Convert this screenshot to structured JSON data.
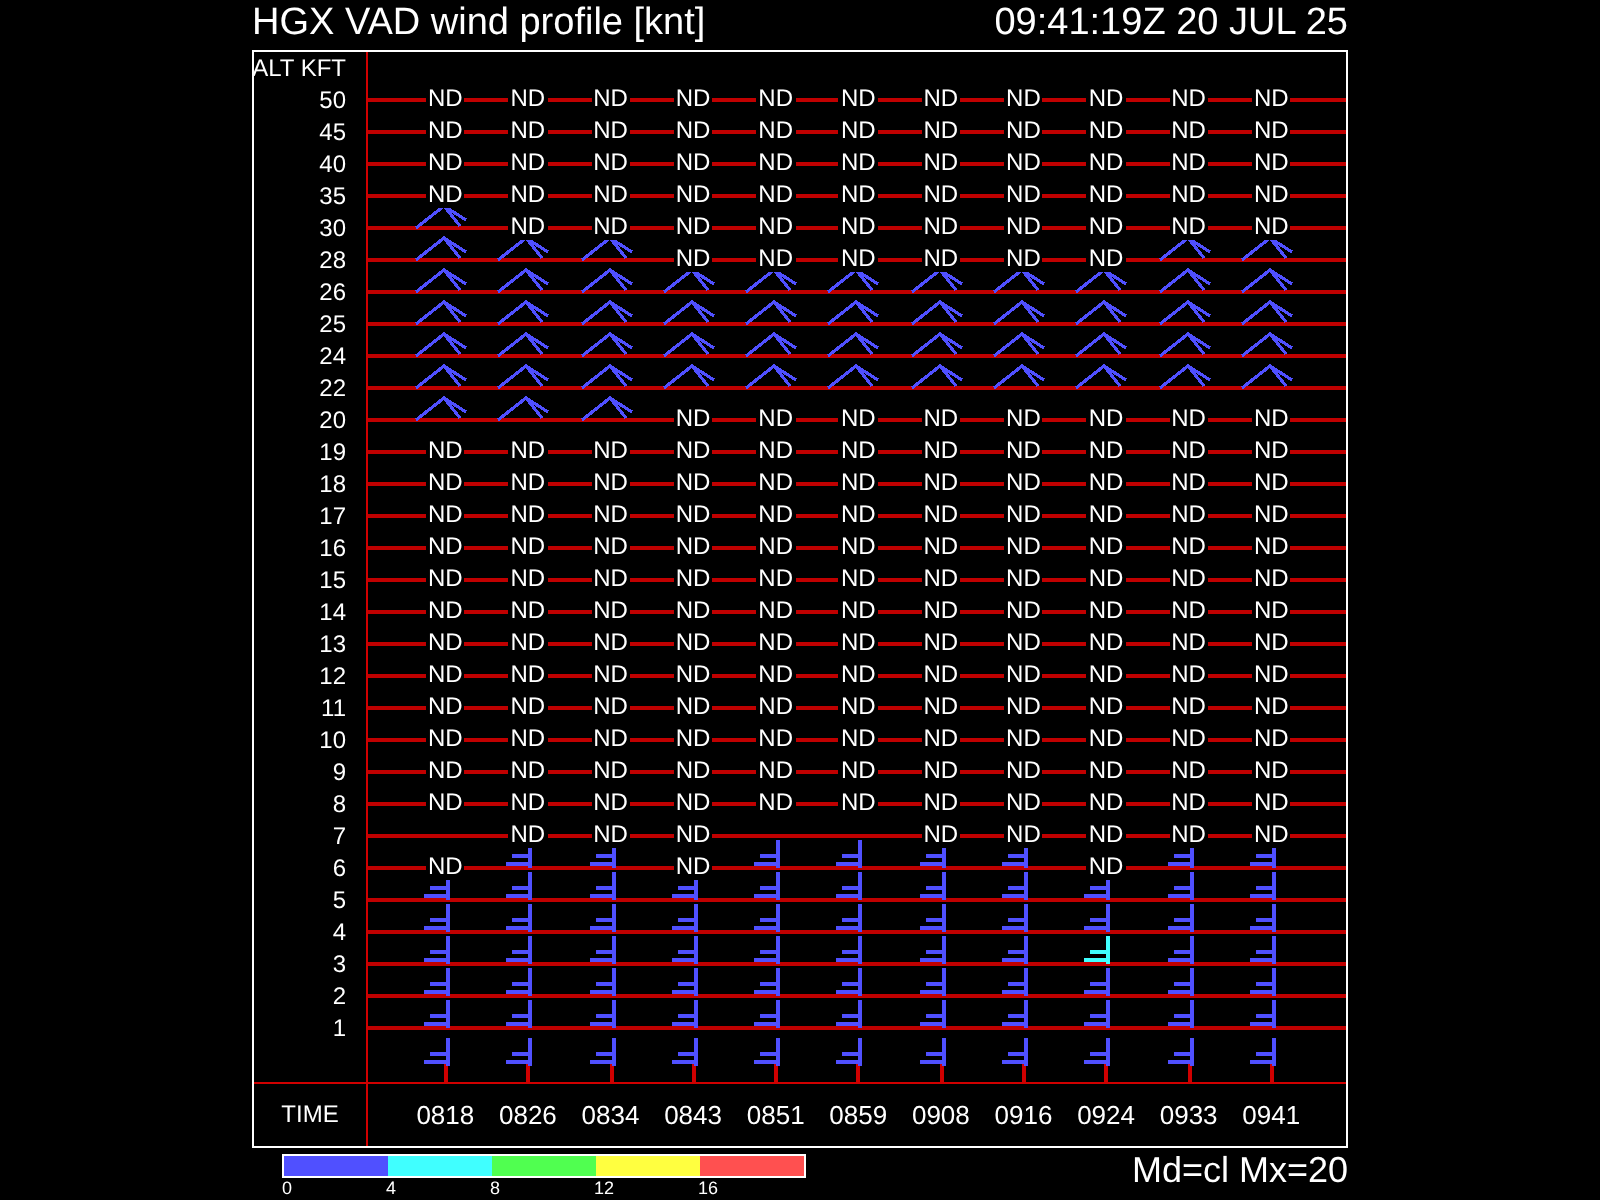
{
  "header": {
    "title": "HGX VAD wind profile [knt]",
    "timestamp": "09:41:19Z 20 JUL 25"
  },
  "profile": {
    "axis_label": "ALT KFT",
    "rows": [
      {
        "altitude": "50",
        "cells": [
          {
            "kind": "nd",
            "text": "ND"
          },
          {
            "kind": "nd",
            "text": "ND"
          },
          {
            "kind": "nd",
            "text": "ND"
          },
          {
            "kind": "nd",
            "text": "ND"
          },
          {
            "kind": "nd",
            "text": "ND"
          },
          {
            "kind": "nd",
            "text": "ND"
          },
          {
            "kind": "nd",
            "text": "ND"
          },
          {
            "kind": "nd",
            "text": "ND"
          },
          {
            "kind": "nd",
            "text": "ND"
          },
          {
            "kind": "nd",
            "text": "ND"
          },
          {
            "kind": "nd",
            "text": "ND"
          }
        ]
      },
      {
        "altitude": "45",
        "cells": [
          {
            "kind": "nd",
            "text": "ND"
          },
          {
            "kind": "nd",
            "text": "ND"
          },
          {
            "kind": "nd",
            "text": "ND"
          },
          {
            "kind": "nd",
            "text": "ND"
          },
          {
            "kind": "nd",
            "text": "ND"
          },
          {
            "kind": "nd",
            "text": "ND"
          },
          {
            "kind": "nd",
            "text": "ND"
          },
          {
            "kind": "nd",
            "text": "ND"
          },
          {
            "kind": "nd",
            "text": "ND"
          },
          {
            "kind": "nd",
            "text": "ND"
          },
          {
            "kind": "nd",
            "text": "ND"
          }
        ]
      },
      {
        "altitude": "40",
        "cells": [
          {
            "kind": "nd",
            "text": "ND"
          },
          {
            "kind": "nd",
            "text": "ND"
          },
          {
            "kind": "nd",
            "text": "ND"
          },
          {
            "kind": "nd",
            "text": "ND"
          },
          {
            "kind": "nd",
            "text": "ND"
          },
          {
            "kind": "nd",
            "text": "ND"
          },
          {
            "kind": "nd",
            "text": "ND"
          },
          {
            "kind": "nd",
            "text": "ND"
          },
          {
            "kind": "nd",
            "text": "ND"
          },
          {
            "kind": "nd",
            "text": "ND"
          },
          {
            "kind": "nd",
            "text": "ND"
          }
        ]
      },
      {
        "altitude": "35",
        "cells": [
          {
            "kind": "nd",
            "text": "ND"
          },
          {
            "kind": "nd",
            "text": "ND"
          },
          {
            "kind": "nd",
            "text": "ND"
          },
          {
            "kind": "nd",
            "text": "ND"
          },
          {
            "kind": "nd",
            "text": "ND"
          },
          {
            "kind": "nd",
            "text": "ND"
          },
          {
            "kind": "nd",
            "text": "ND"
          },
          {
            "kind": "nd",
            "text": "ND"
          },
          {
            "kind": "nd",
            "text": "ND"
          },
          {
            "kind": "nd",
            "text": "ND"
          },
          {
            "kind": "nd",
            "text": "ND"
          }
        ]
      },
      {
        "altitude": "30",
        "cells": [
          {
            "kind": "barb",
            "color": "#5050ff"
          },
          {
            "kind": "nd",
            "text": "ND"
          },
          {
            "kind": "nd",
            "text": "ND"
          },
          {
            "kind": "nd",
            "text": "ND"
          },
          {
            "kind": "nd",
            "text": "ND"
          },
          {
            "kind": "nd",
            "text": "ND"
          },
          {
            "kind": "nd",
            "text": "ND"
          },
          {
            "kind": "nd",
            "text": "ND"
          },
          {
            "kind": "nd",
            "text": "ND"
          },
          {
            "kind": "nd",
            "text": "ND"
          },
          {
            "kind": "nd",
            "text": "ND"
          }
        ]
      },
      {
        "altitude": "28",
        "cells": [
          {
            "kind": "barb",
            "color": "#5050ff"
          },
          {
            "kind": "barb",
            "color": "#5050ff"
          },
          {
            "kind": "barb",
            "color": "#5050ff"
          },
          {
            "kind": "nd",
            "text": "ND"
          },
          {
            "kind": "nd",
            "text": "ND"
          },
          {
            "kind": "nd",
            "text": "ND"
          },
          {
            "kind": "nd",
            "text": "ND"
          },
          {
            "kind": "nd",
            "text": "ND"
          },
          {
            "kind": "nd",
            "text": "ND"
          },
          {
            "kind": "barb",
            "color": "#5050ff"
          },
          {
            "kind": "barb",
            "color": "#5050ff"
          }
        ]
      },
      {
        "altitude": "26",
        "cells": [
          {
            "kind": "barb",
            "color": "#5050ff"
          },
          {
            "kind": "barb",
            "color": "#5050ff"
          },
          {
            "kind": "barb",
            "color": "#5050ff"
          },
          {
            "kind": "barb",
            "color": "#5050ff"
          },
          {
            "kind": "barb",
            "color": "#5050ff"
          },
          {
            "kind": "barb",
            "color": "#5050ff"
          },
          {
            "kind": "barb",
            "color": "#5050ff"
          },
          {
            "kind": "barb",
            "color": "#5050ff"
          },
          {
            "kind": "barb",
            "color": "#5050ff"
          },
          {
            "kind": "barb",
            "color": "#5050ff"
          },
          {
            "kind": "barb",
            "color": "#5050ff"
          }
        ]
      },
      {
        "altitude": "25",
        "cells": [
          {
            "kind": "barb",
            "color": "#5050ff"
          },
          {
            "kind": "barb",
            "color": "#5050ff"
          },
          {
            "kind": "barb",
            "color": "#5050ff"
          },
          {
            "kind": "barb",
            "color": "#5050ff"
          },
          {
            "kind": "barb",
            "color": "#5050ff"
          },
          {
            "kind": "barb",
            "color": "#5050ff"
          },
          {
            "kind": "barb",
            "color": "#5050ff"
          },
          {
            "kind": "barb",
            "color": "#5050ff"
          },
          {
            "kind": "barb",
            "color": "#5050ff"
          },
          {
            "kind": "barb",
            "color": "#5050ff"
          },
          {
            "kind": "barb",
            "color": "#5050ff"
          }
        ]
      },
      {
        "altitude": "24",
        "cells": [
          {
            "kind": "barb",
            "color": "#5050ff"
          },
          {
            "kind": "barb",
            "color": "#5050ff"
          },
          {
            "kind": "barb",
            "color": "#5050ff"
          },
          {
            "kind": "barb",
            "color": "#5050ff"
          },
          {
            "kind": "barb",
            "color": "#5050ff"
          },
          {
            "kind": "barb",
            "color": "#5050ff"
          },
          {
            "kind": "barb",
            "color": "#5050ff"
          },
          {
            "kind": "barb",
            "color": "#5050ff"
          },
          {
            "kind": "barb",
            "color": "#5050ff"
          },
          {
            "kind": "barb",
            "color": "#5050ff"
          },
          {
            "kind": "barb",
            "color": "#5050ff"
          }
        ]
      },
      {
        "altitude": "22",
        "cells": [
          {
            "kind": "barb",
            "color": "#5050ff"
          },
          {
            "kind": "barb",
            "color": "#5050ff"
          },
          {
            "kind": "barb",
            "color": "#5050ff"
          },
          {
            "kind": "barb",
            "color": "#5050ff"
          },
          {
            "kind": "barb",
            "color": "#5050ff"
          },
          {
            "kind": "barb",
            "color": "#5050ff"
          },
          {
            "kind": "barb",
            "color": "#5050ff"
          },
          {
            "kind": "barb",
            "color": "#5050ff"
          },
          {
            "kind": "barb",
            "color": "#5050ff"
          },
          {
            "kind": "barb",
            "color": "#5050ff"
          },
          {
            "kind": "barb",
            "color": "#5050ff"
          }
        ]
      },
      {
        "altitude": "20",
        "cells": [
          {
            "kind": "barb",
            "color": "#5050ff"
          },
          {
            "kind": "barb",
            "color": "#5050ff"
          },
          {
            "kind": "barb",
            "color": "#5050ff"
          },
          {
            "kind": "nd",
            "text": "ND"
          },
          {
            "kind": "nd",
            "text": "ND"
          },
          {
            "kind": "nd",
            "text": "ND"
          },
          {
            "kind": "nd",
            "text": "ND"
          },
          {
            "kind": "nd",
            "text": "ND"
          },
          {
            "kind": "nd",
            "text": "ND"
          },
          {
            "kind": "nd",
            "text": "ND"
          },
          {
            "kind": "nd",
            "text": "ND"
          }
        ]
      },
      {
        "altitude": "19",
        "cells": [
          {
            "kind": "nd",
            "text": "ND"
          },
          {
            "kind": "nd",
            "text": "ND"
          },
          {
            "kind": "nd",
            "text": "ND"
          },
          {
            "kind": "nd",
            "text": "ND"
          },
          {
            "kind": "nd",
            "text": "ND"
          },
          {
            "kind": "nd",
            "text": "ND"
          },
          {
            "kind": "nd",
            "text": "ND"
          },
          {
            "kind": "nd",
            "text": "ND"
          },
          {
            "kind": "nd",
            "text": "ND"
          },
          {
            "kind": "nd",
            "text": "ND"
          },
          {
            "kind": "nd",
            "text": "ND"
          }
        ]
      },
      {
        "altitude": "18",
        "cells": [
          {
            "kind": "nd",
            "text": "ND"
          },
          {
            "kind": "nd",
            "text": "ND"
          },
          {
            "kind": "nd",
            "text": "ND"
          },
          {
            "kind": "nd",
            "text": "ND"
          },
          {
            "kind": "nd",
            "text": "ND"
          },
          {
            "kind": "nd",
            "text": "ND"
          },
          {
            "kind": "nd",
            "text": "ND"
          },
          {
            "kind": "nd",
            "text": "ND"
          },
          {
            "kind": "nd",
            "text": "ND"
          },
          {
            "kind": "nd",
            "text": "ND"
          },
          {
            "kind": "nd",
            "text": "ND"
          }
        ]
      },
      {
        "altitude": "17",
        "cells": [
          {
            "kind": "nd",
            "text": "ND"
          },
          {
            "kind": "nd",
            "text": "ND"
          },
          {
            "kind": "nd",
            "text": "ND"
          },
          {
            "kind": "nd",
            "text": "ND"
          },
          {
            "kind": "nd",
            "text": "ND"
          },
          {
            "kind": "nd",
            "text": "ND"
          },
          {
            "kind": "nd",
            "text": "ND"
          },
          {
            "kind": "nd",
            "text": "ND"
          },
          {
            "kind": "nd",
            "text": "ND"
          },
          {
            "kind": "nd",
            "text": "ND"
          },
          {
            "kind": "nd",
            "text": "ND"
          }
        ]
      },
      {
        "altitude": "16",
        "cells": [
          {
            "kind": "nd",
            "text": "ND"
          },
          {
            "kind": "nd",
            "text": "ND"
          },
          {
            "kind": "nd",
            "text": "ND"
          },
          {
            "kind": "nd",
            "text": "ND"
          },
          {
            "kind": "nd",
            "text": "ND"
          },
          {
            "kind": "nd",
            "text": "ND"
          },
          {
            "kind": "nd",
            "text": "ND"
          },
          {
            "kind": "nd",
            "text": "ND"
          },
          {
            "kind": "nd",
            "text": "ND"
          },
          {
            "kind": "nd",
            "text": "ND"
          },
          {
            "kind": "nd",
            "text": "ND"
          }
        ]
      },
      {
        "altitude": "15",
        "cells": [
          {
            "kind": "nd",
            "text": "ND"
          },
          {
            "kind": "nd",
            "text": "ND"
          },
          {
            "kind": "nd",
            "text": "ND"
          },
          {
            "kind": "nd",
            "text": "ND"
          },
          {
            "kind": "nd",
            "text": "ND"
          },
          {
            "kind": "nd",
            "text": "ND"
          },
          {
            "kind": "nd",
            "text": "ND"
          },
          {
            "kind": "nd",
            "text": "ND"
          },
          {
            "kind": "nd",
            "text": "ND"
          },
          {
            "kind": "nd",
            "text": "ND"
          },
          {
            "kind": "nd",
            "text": "ND"
          }
        ]
      },
      {
        "altitude": "14",
        "cells": [
          {
            "kind": "nd",
            "text": "ND"
          },
          {
            "kind": "nd",
            "text": "ND"
          },
          {
            "kind": "nd",
            "text": "ND"
          },
          {
            "kind": "nd",
            "text": "ND"
          },
          {
            "kind": "nd",
            "text": "ND"
          },
          {
            "kind": "nd",
            "text": "ND"
          },
          {
            "kind": "nd",
            "text": "ND"
          },
          {
            "kind": "nd",
            "text": "ND"
          },
          {
            "kind": "nd",
            "text": "ND"
          },
          {
            "kind": "nd",
            "text": "ND"
          },
          {
            "kind": "nd",
            "text": "ND"
          }
        ]
      },
      {
        "altitude": "13",
        "cells": [
          {
            "kind": "nd",
            "text": "ND"
          },
          {
            "kind": "nd",
            "text": "ND"
          },
          {
            "kind": "nd",
            "text": "ND"
          },
          {
            "kind": "nd",
            "text": "ND"
          },
          {
            "kind": "nd",
            "text": "ND"
          },
          {
            "kind": "nd",
            "text": "ND"
          },
          {
            "kind": "nd",
            "text": "ND"
          },
          {
            "kind": "nd",
            "text": "ND"
          },
          {
            "kind": "nd",
            "text": "ND"
          },
          {
            "kind": "nd",
            "text": "ND"
          },
          {
            "kind": "nd",
            "text": "ND"
          }
        ]
      },
      {
        "altitude": "12",
        "cells": [
          {
            "kind": "nd",
            "text": "ND"
          },
          {
            "kind": "nd",
            "text": "ND"
          },
          {
            "kind": "nd",
            "text": "ND"
          },
          {
            "kind": "nd",
            "text": "ND"
          },
          {
            "kind": "nd",
            "text": "ND"
          },
          {
            "kind": "nd",
            "text": "ND"
          },
          {
            "kind": "nd",
            "text": "ND"
          },
          {
            "kind": "nd",
            "text": "ND"
          },
          {
            "kind": "nd",
            "text": "ND"
          },
          {
            "kind": "nd",
            "text": "ND"
          },
          {
            "kind": "nd",
            "text": "ND"
          }
        ]
      },
      {
        "altitude": "11",
        "cells": [
          {
            "kind": "nd",
            "text": "ND"
          },
          {
            "kind": "nd",
            "text": "ND"
          },
          {
            "kind": "nd",
            "text": "ND"
          },
          {
            "kind": "nd",
            "text": "ND"
          },
          {
            "kind": "nd",
            "text": "ND"
          },
          {
            "kind": "nd",
            "text": "ND"
          },
          {
            "kind": "nd",
            "text": "ND"
          },
          {
            "kind": "nd",
            "text": "ND"
          },
          {
            "kind": "nd",
            "text": "ND"
          },
          {
            "kind": "nd",
            "text": "ND"
          },
          {
            "kind": "nd",
            "text": "ND"
          }
        ]
      },
      {
        "altitude": "10",
        "cells": [
          {
            "kind": "nd",
            "text": "ND"
          },
          {
            "kind": "nd",
            "text": "ND"
          },
          {
            "kind": "nd",
            "text": "ND"
          },
          {
            "kind": "nd",
            "text": "ND"
          },
          {
            "kind": "nd",
            "text": "ND"
          },
          {
            "kind": "nd",
            "text": "ND"
          },
          {
            "kind": "nd",
            "text": "ND"
          },
          {
            "kind": "nd",
            "text": "ND"
          },
          {
            "kind": "nd",
            "text": "ND"
          },
          {
            "kind": "nd",
            "text": "ND"
          },
          {
            "kind": "nd",
            "text": "ND"
          }
        ]
      },
      {
        "altitude": "9",
        "cells": [
          {
            "kind": "nd",
            "text": "ND"
          },
          {
            "kind": "nd",
            "text": "ND"
          },
          {
            "kind": "nd",
            "text": "ND"
          },
          {
            "kind": "nd",
            "text": "ND"
          },
          {
            "kind": "nd",
            "text": "ND"
          },
          {
            "kind": "nd",
            "text": "ND"
          },
          {
            "kind": "nd",
            "text": "ND"
          },
          {
            "kind": "nd",
            "text": "ND"
          },
          {
            "kind": "nd",
            "text": "ND"
          },
          {
            "kind": "nd",
            "text": "ND"
          },
          {
            "kind": "nd",
            "text": "ND"
          }
        ]
      },
      {
        "altitude": "8",
        "cells": [
          {
            "kind": "nd",
            "text": "ND"
          },
          {
            "kind": "nd",
            "text": "ND"
          },
          {
            "kind": "nd",
            "text": "ND"
          },
          {
            "kind": "nd",
            "text": "ND"
          },
          {
            "kind": "nd",
            "text": "ND"
          },
          {
            "kind": "nd",
            "text": "ND"
          },
          {
            "kind": "nd",
            "text": "ND"
          },
          {
            "kind": "nd",
            "text": "ND"
          },
          {
            "kind": "nd",
            "text": "ND"
          },
          {
            "kind": "nd",
            "text": "ND"
          },
          {
            "kind": "nd",
            "text": "ND"
          }
        ]
      },
      {
        "altitude": "7",
        "cells": [
          {
            "kind": "empty"
          },
          {
            "kind": "nd",
            "text": "ND"
          },
          {
            "kind": "nd",
            "text": "ND"
          },
          {
            "kind": "nd",
            "text": "ND"
          },
          {
            "kind": "empty"
          },
          {
            "kind": "empty"
          },
          {
            "kind": "nd",
            "text": "ND"
          },
          {
            "kind": "nd",
            "text": "ND"
          },
          {
            "kind": "nd",
            "text": "ND"
          },
          {
            "kind": "nd",
            "text": "ND"
          },
          {
            "kind": "nd",
            "text": "ND"
          }
        ]
      },
      {
        "altitude": "6",
        "cells": [
          {
            "kind": "nd",
            "text": "ND"
          },
          {
            "kind": "barb",
            "color": "#5050ff"
          },
          {
            "kind": "barb",
            "color": "#5050ff"
          },
          {
            "kind": "nd",
            "text": "ND"
          },
          {
            "kind": "barb",
            "color": "#5050ff"
          },
          {
            "kind": "barb",
            "color": "#5050ff"
          },
          {
            "kind": "barb",
            "color": "#5050ff"
          },
          {
            "kind": "barb",
            "color": "#5050ff"
          },
          {
            "kind": "nd",
            "text": "ND"
          },
          {
            "kind": "barb",
            "color": "#5050ff"
          },
          {
            "kind": "barb",
            "color": "#5050ff"
          }
        ]
      },
      {
        "altitude": "5",
        "cells": [
          {
            "kind": "barb",
            "color": "#5050ff"
          },
          {
            "kind": "barb",
            "color": "#5050ff"
          },
          {
            "kind": "barb",
            "color": "#5050ff"
          },
          {
            "kind": "barb",
            "color": "#5050ff"
          },
          {
            "kind": "barb",
            "color": "#5050ff"
          },
          {
            "kind": "barb",
            "color": "#5050ff"
          },
          {
            "kind": "barb",
            "color": "#5050ff"
          },
          {
            "kind": "barb",
            "color": "#5050ff"
          },
          {
            "kind": "barb",
            "color": "#5050ff"
          },
          {
            "kind": "barb",
            "color": "#5050ff"
          },
          {
            "kind": "barb",
            "color": "#5050ff"
          }
        ]
      },
      {
        "altitude": "4",
        "cells": [
          {
            "kind": "barb",
            "color": "#5050ff"
          },
          {
            "kind": "barb",
            "color": "#5050ff"
          },
          {
            "kind": "barb",
            "color": "#5050ff"
          },
          {
            "kind": "barb",
            "color": "#5050ff"
          },
          {
            "kind": "barb",
            "color": "#5050ff"
          },
          {
            "kind": "barb",
            "color": "#5050ff"
          },
          {
            "kind": "barb",
            "color": "#5050ff"
          },
          {
            "kind": "barb",
            "color": "#5050ff"
          },
          {
            "kind": "barb",
            "color": "#5050ff"
          },
          {
            "kind": "barb",
            "color": "#5050ff"
          },
          {
            "kind": "barb",
            "color": "#5050ff"
          }
        ]
      },
      {
        "altitude": "3",
        "cells": [
          {
            "kind": "barb",
            "color": "#5050ff"
          },
          {
            "kind": "barb",
            "color": "#5050ff"
          },
          {
            "kind": "barb",
            "color": "#5050ff"
          },
          {
            "kind": "barb",
            "color": "#5050ff"
          },
          {
            "kind": "barb",
            "color": "#5050ff"
          },
          {
            "kind": "barb",
            "color": "#5050ff"
          },
          {
            "kind": "barb",
            "color": "#5050ff"
          },
          {
            "kind": "barb",
            "color": "#5050ff"
          },
          {
            "kind": "barb",
            "color": "#40ffff"
          },
          {
            "kind": "barb",
            "color": "#5050ff"
          },
          {
            "kind": "barb",
            "color": "#5050ff"
          }
        ]
      },
      {
        "altitude": "2",
        "cells": [
          {
            "kind": "barb",
            "color": "#5050ff"
          },
          {
            "kind": "barb",
            "color": "#5050ff"
          },
          {
            "kind": "barb",
            "color": "#5050ff"
          },
          {
            "kind": "barb",
            "color": "#5050ff"
          },
          {
            "kind": "barb",
            "color": "#5050ff"
          },
          {
            "kind": "barb",
            "color": "#5050ff"
          },
          {
            "kind": "barb",
            "color": "#5050ff"
          },
          {
            "kind": "barb",
            "color": "#5050ff"
          },
          {
            "kind": "barb",
            "color": "#5050ff"
          },
          {
            "kind": "barb",
            "color": "#5050ff"
          },
          {
            "kind": "barb",
            "color": "#5050ff"
          }
        ]
      },
      {
        "altitude": "1",
        "cells": [
          {
            "kind": "barb",
            "color": "#5050ff"
          },
          {
            "kind": "barb",
            "color": "#5050ff"
          },
          {
            "kind": "barb",
            "color": "#5050ff"
          },
          {
            "kind": "barb",
            "color": "#5050ff"
          },
          {
            "kind": "barb",
            "color": "#5050ff"
          },
          {
            "kind": "barb",
            "color": "#5050ff"
          },
          {
            "kind": "barb",
            "color": "#5050ff"
          },
          {
            "kind": "barb",
            "color": "#5050ff"
          },
          {
            "kind": "barb",
            "color": "#5050ff"
          },
          {
            "kind": "barb",
            "color": "#5050ff"
          },
          {
            "kind": "barb",
            "color": "#5050ff"
          }
        ]
      }
    ],
    "ground": [
      {
        "kind": "barb",
        "color": "#5050ff"
      },
      {
        "kind": "barb",
        "color": "#5050ff"
      },
      {
        "kind": "barb",
        "color": "#5050ff"
      },
      {
        "kind": "barb",
        "color": "#5050ff"
      },
      {
        "kind": "barb",
        "color": "#5050ff"
      },
      {
        "kind": "barb",
        "color": "#5050ff"
      },
      {
        "kind": "barb",
        "color": "#5050ff"
      },
      {
        "kind": "barb",
        "color": "#5050ff"
      },
      {
        "kind": "barb",
        "color": "#5050ff"
      },
      {
        "kind": "barb",
        "color": "#5050ff"
      },
      {
        "kind": "barb",
        "color": "#5050ff"
      }
    ],
    "time_label": "TIME",
    "times": [
      "0818",
      "0826",
      "0834",
      "0843",
      "0851",
      "0859",
      "0908",
      "0916",
      "0924",
      "0933",
      "0941"
    ]
  },
  "legend": {
    "segments": [
      {
        "color": "#5050ff",
        "label": "0"
      },
      {
        "color": "#40ffff",
        "label": "4"
      },
      {
        "color": "#50ff50",
        "label": "8"
      },
      {
        "color": "#ffff40",
        "label": "12"
      },
      {
        "color": "#ff5050",
        "label": "16"
      }
    ]
  },
  "mode_text": "Md=cl Mx=20"
}
